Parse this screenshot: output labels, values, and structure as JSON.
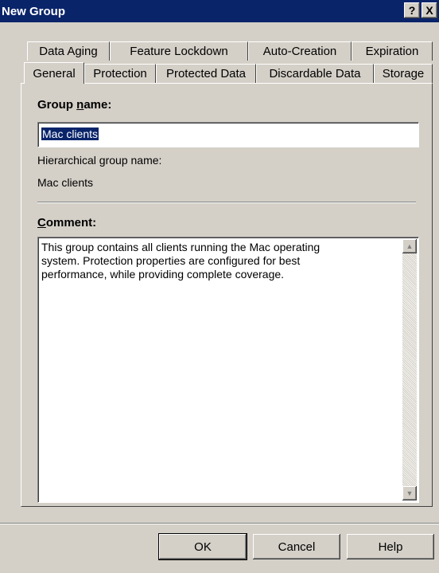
{
  "window": {
    "title": "New Group",
    "help_btn": "?",
    "close_btn": "X"
  },
  "tabs_back": [
    "Data Aging",
    "Feature Lockdown",
    "Auto-Creation",
    "Expiration"
  ],
  "tabs_front": [
    "General",
    "Protection",
    "Protected Data",
    "Discardable Data",
    "Storage"
  ],
  "active_tab": "General",
  "form": {
    "group_name_label_pre": "Group ",
    "group_name_label_key": "n",
    "group_name_label_post": "ame:",
    "group_name_value": "Mac clients",
    "hier_label": "Hierarchical group name:",
    "hier_value": "Mac clients",
    "comment_label_key": "C",
    "comment_label_post": "omment:",
    "comment_text": "This group contains all clients running the Mac operating\nsystem. Protection properties are configured for best\nperformance, while providing complete coverage."
  },
  "scroll_icons": {
    "up": "▲",
    "down": "▼"
  },
  "buttons": {
    "ok": "OK",
    "cancel": "Cancel",
    "help": "Help"
  }
}
